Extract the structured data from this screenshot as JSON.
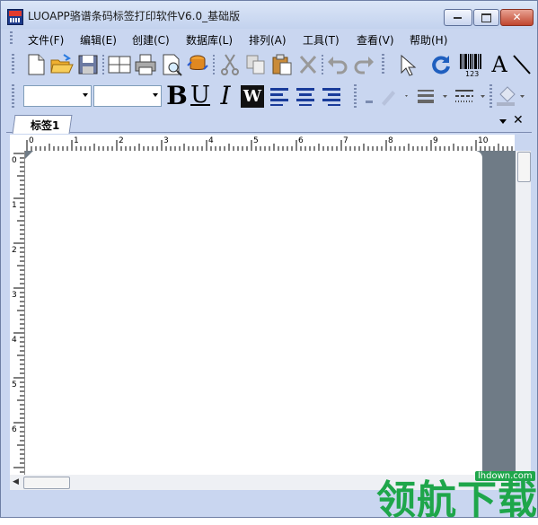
{
  "window": {
    "title": "LUOAPP骆谱条码标签打印软件V6.0_基础版",
    "app_icon": "luoapp-app-icon",
    "controls": {
      "minimize": "minimize-icon",
      "maximize": "maximize-icon",
      "close": "close-icon"
    }
  },
  "menu": {
    "items": [
      {
        "label": "文件(F)"
      },
      {
        "label": "编辑(E)"
      },
      {
        "label": "创建(C)"
      },
      {
        "label": "数据库(L)"
      },
      {
        "label": "排列(A)"
      },
      {
        "label": "工具(T)"
      },
      {
        "label": "查看(V)"
      },
      {
        "label": "帮助(H)"
      }
    ]
  },
  "toolbar1": {
    "buttons": [
      "new-file-icon",
      "open-folder-icon",
      "save-icon",
      "page-setup-icon",
      "print-icon",
      "print-preview-icon",
      "database-icon",
      "cut-icon",
      "copy-icon",
      "paste-icon",
      "delete-icon",
      "undo-icon",
      "redo-icon",
      "select-pointer-icon",
      "rotate-icon",
      "barcode-icon",
      "text-tool-icon",
      "line-tool-icon"
    ],
    "barcode_caption": "123",
    "text_tool_glyph": "A"
  },
  "toolbar2": {
    "font_name_value": "",
    "font_size_value": "",
    "buttons": {
      "bold": "B",
      "underline": "U",
      "italic": "I",
      "wordwrap": "W"
    },
    "align_icons": [
      "align-left-icon",
      "align-center-icon",
      "align-right-icon"
    ],
    "style_icons": [
      "line-color-icon",
      "line-width-icon",
      "line-style-icon",
      "fill-color-icon"
    ]
  },
  "tabs": {
    "items": [
      {
        "label": "标签1"
      }
    ],
    "dropdown_icon": "tab-list-icon",
    "close_icon": "tab-close-icon"
  },
  "ruler": {
    "horizontal_labels": [
      "0",
      "1",
      "2",
      "3",
      "4",
      "5",
      "6",
      "7",
      "8",
      "9",
      "10"
    ],
    "vertical_labels": [
      "0",
      "1",
      "2",
      "3",
      "4",
      "5",
      "6"
    ]
  },
  "watermark": {
    "text": "领航下载",
    "url": "lhdown.com"
  },
  "colors": {
    "chrome": "#c9d6f0",
    "workspace": "#6f7b86",
    "paper": "#ffffff",
    "watermark": "#1ea64a"
  }
}
